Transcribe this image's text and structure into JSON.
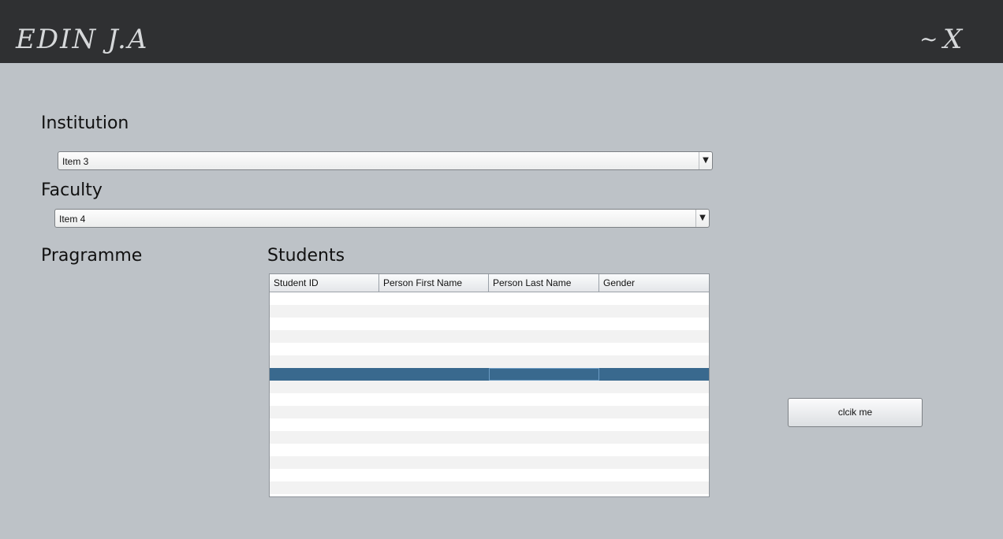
{
  "window": {
    "title": "EDIN J.A",
    "minimize_label": "~",
    "close_label": "X"
  },
  "institution": {
    "label": "Institution",
    "selected": "Item 3"
  },
  "faculty": {
    "label": "Faculty",
    "selected": "Item 4"
  },
  "programme": {
    "label": "Pragramme"
  },
  "students": {
    "label": "Students",
    "columns": [
      "Student ID",
      "Person First Name",
      "Person Last Name",
      "Gender"
    ],
    "row_count": 16,
    "selected_row": 6,
    "focused_column": 2
  },
  "action_button": {
    "label": "clcik me"
  },
  "colors": {
    "titlebar": "#2f3032",
    "background": "#bdc2c7",
    "selection": "#39698e"
  },
  "icons": {
    "combo_arrow": "chevron-down-icon"
  }
}
